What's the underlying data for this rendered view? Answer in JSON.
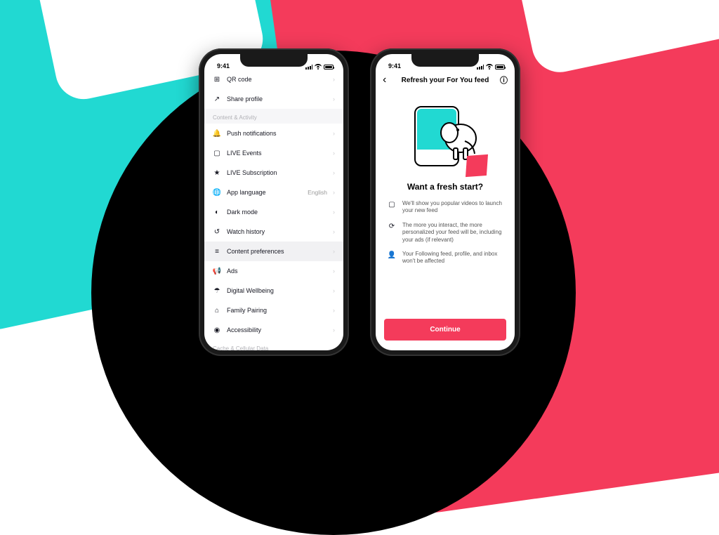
{
  "status": {
    "time": "9:41"
  },
  "leftPhone": {
    "rows_top": [
      {
        "icon": "qr-icon",
        "label": "QR code"
      },
      {
        "icon": "share-icon",
        "label": "Share profile"
      }
    ],
    "section1_header": "Content & Activity",
    "rows_main": [
      {
        "icon": "bell-icon",
        "label": "Push notifications",
        "highlight": false
      },
      {
        "icon": "live-icon",
        "label": "LIVE Events",
        "highlight": false
      },
      {
        "icon": "livesub-icon",
        "label": "LIVE Subscription",
        "highlight": false
      },
      {
        "icon": "language-icon",
        "label": "App language",
        "value": "English",
        "highlight": false
      },
      {
        "icon": "dark-icon",
        "label": "Dark mode",
        "highlight": false
      },
      {
        "icon": "history-icon",
        "label": "Watch history",
        "highlight": false
      },
      {
        "icon": "content-icon",
        "label": "Content preferences",
        "highlight": true
      },
      {
        "icon": "ads-icon",
        "label": "Ads",
        "highlight": false
      },
      {
        "icon": "wellbeing-icon",
        "label": "Digital Wellbeing",
        "highlight": false
      },
      {
        "icon": "family-icon",
        "label": "Family Pairing",
        "highlight": false
      },
      {
        "icon": "accessibility-icon",
        "label": "Accessibility",
        "highlight": false
      }
    ],
    "footer": "Cache & Cellular Data"
  },
  "rightPhone": {
    "nav_title": "Refresh your For You feed",
    "headline": "Want a fresh start?",
    "benefits": [
      {
        "icon": "video-icon",
        "text": "We'll show you popular videos to launch your new feed"
      },
      {
        "icon": "refresh-icon",
        "text": "The more you interact, the more personalized your feed will be, including your ads (if relevant)"
      },
      {
        "icon": "person-icon",
        "text": "Your Following feed, profile, and inbox won't be affected"
      }
    ],
    "cta": "Continue"
  },
  "icons": {
    "qr-icon": "⊞",
    "share-icon": "↗",
    "bell-icon": "🔔",
    "live-icon": "▢",
    "livesub-icon": "★",
    "language-icon": "🌐",
    "dark-icon": "◐",
    "history-icon": "↺",
    "content-icon": "≡",
    "ads-icon": "📢",
    "wellbeing-icon": "☂",
    "family-icon": "⌂",
    "accessibility-icon": "◉",
    "video-icon": "▢",
    "refresh-icon": "⟳",
    "person-icon": "👤",
    "chevron": "›",
    "back": "‹",
    "info": "ⓘ"
  }
}
